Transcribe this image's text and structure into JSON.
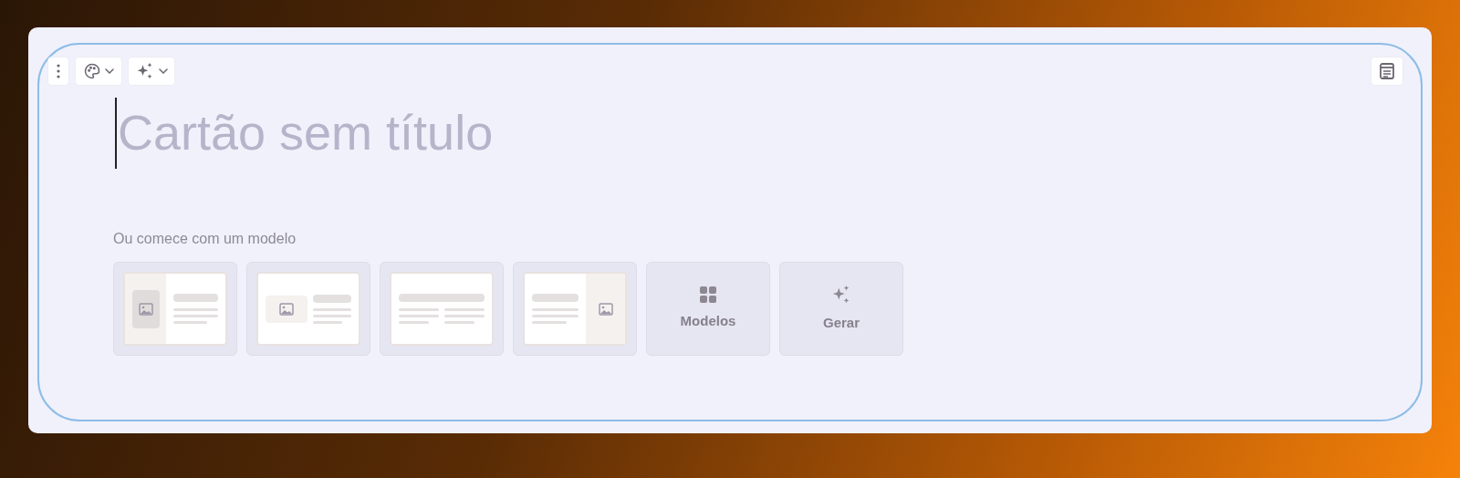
{
  "card": {
    "title": {
      "placeholder": "Cartão sem título"
    },
    "templates_label": "Ou comece com um modelo",
    "templates": [
      {
        "kind": "image-left"
      },
      {
        "kind": "image-block"
      },
      {
        "kind": "two-columns"
      },
      {
        "kind": "image-right"
      }
    ],
    "actions": [
      {
        "kind": "grid",
        "label": "Modelos"
      },
      {
        "kind": "sparkle",
        "label": "Gerar"
      }
    ]
  }
}
